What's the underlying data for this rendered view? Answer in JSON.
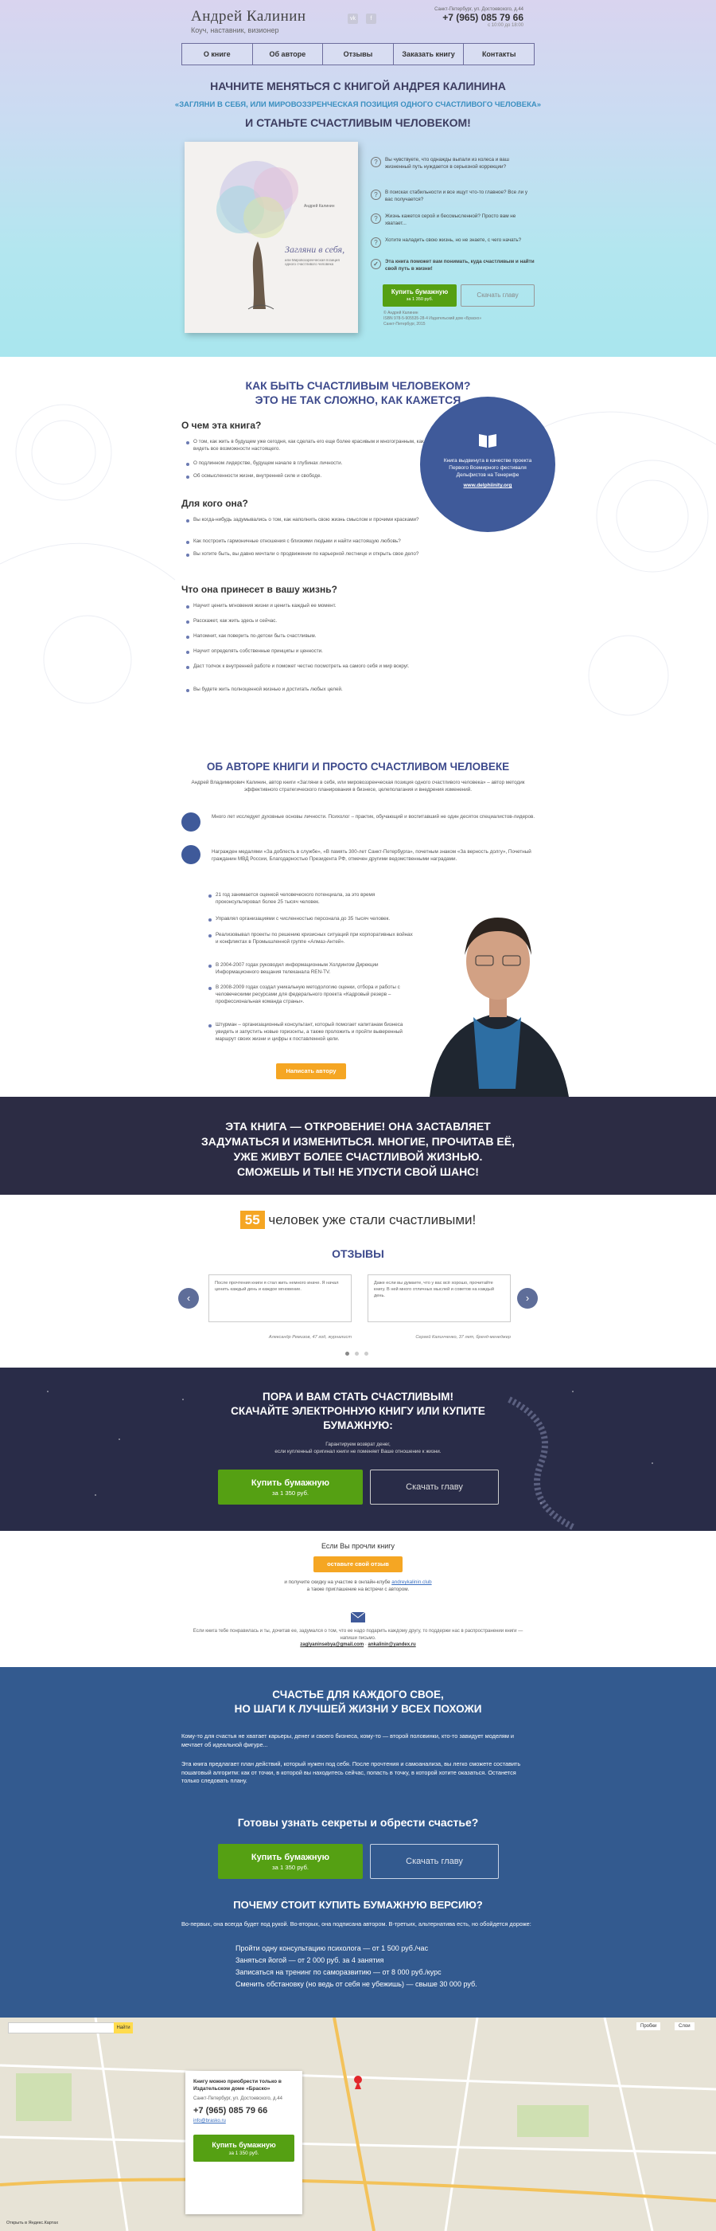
{
  "header": {
    "name": "Андрей Калинин",
    "tagline": "Коуч, наставник, визионер",
    "social": [
      "vk",
      "f"
    ],
    "city": "Санкт-Петербург, ул. Достоевского, д.44",
    "phone": "+7 (965) 085 79 66",
    "hours": "с 10:00 до 18:00"
  },
  "nav": [
    "О книге",
    "Об авторе",
    "Отзывы",
    "Заказать книгу",
    "Контакты"
  ],
  "hero": {
    "line1": "НАЧНИТЕ МЕНЯТЬСЯ С КНИГОЙ АНДРЕЯ КАЛИНИНА",
    "line2": "«ЗАГЛЯНИ В СЕБЯ, ИЛИ МИРОВОЗЗРЕНЧЕСКАЯ ПОЗИЦИЯ ОДНОГО СЧАСТЛИВОГО ЧЕЛОВЕКА»",
    "line3": "И СТАНЬТЕ СЧАСТЛИВЫМ ЧЕЛОВЕКОМ!",
    "book_author": "Андрей Калинин",
    "book_title": "Загляни в себя,",
    "book_sub": "или Мировоззренческая позиция одного счастливого человека",
    "questions": [
      "Вы чувствуете, что однажды выпали из колеса и ваш жизненный путь нуждается в серьезной коррекции?",
      "В поисках стабильности и все ищут что-то главное? Все ли у вас получается?",
      "Жизнь кажется серой и бессмысленной? Просто вам не хватает...",
      "Хотите наладить свою жизнь, но не знаете, с чего начать?"
    ],
    "cta_note": "Эта книга поможет вам понимать, куда счастливым и найти свой путь в жизни!",
    "buy_label": "Купить бумажную",
    "buy_price": "за 1 350 руб.",
    "download_label": "Скачать главу",
    "meta": "© Андрей Калинин\nISBN 978-5-905535-28-4 Издательский дом «Браско»\nСанкт-Петербург, 2015"
  },
  "about": {
    "title1": "КАК БЫТЬ СЧАСТЛИВЫМ ЧЕЛОВЕКОМ?",
    "title2": "ЭТО НЕ ТАК СЛОЖНО, КАК КАЖЕТСЯ",
    "s1": "О чем эта книга?",
    "s1_items": [
      "О том, как жить в будущем уже сегодня, как сделать его еще более красивым и многогранным, как видеть все возможности настоящего.",
      "О подлинном лидерстве, будущем начале в глубинах личности.",
      "Об осмысленности жизни, внутренней силе и свободе."
    ],
    "s2": "Для кого она?",
    "s2_items": [
      "Вы когда-нибудь задумывались о том, как наполнить свою жизнь смыслом и прочими красками?",
      "Как построить гармоничные отношения с близкими людьми и найти настоящую любовь?",
      "Вы хотите быть, вы давно мечтали о продвижении по карьерной лестнице и открыть свое дело?"
    ],
    "s3": "Что она принесет в вашу жизнь?",
    "s3_items": [
      "Научит ценить мгновения жизни и ценить каждый ее момент.",
      "Расскажет, как жить здесь и сейчас.",
      "Напомнит, как поверить по-детски быть счастливым.",
      "Научит определять собственные принципы и ценности.",
      "Даст толчок к внутренней работе и поможет честно посмотреть на самого себя и мир вокруг.",
      "Вы будете жить полноценной жизнью и достигать любых целей."
    ],
    "badge": "Книга выдвинута в качестве проекта Первого Всемирного фестиваля Дельфистов на Тенерифе",
    "badge_link": "www.delphiinity.org"
  },
  "author": {
    "title": "ОБ АВТОРЕ КНИГИ И ПРОСТО СЧАСТЛИВОМ ЧЕЛОВЕКЕ",
    "intro": "Андрей Владимирович Калинин, автор книги «Загляни в себя, или мировоззренческая позиция одного счастливого человека» – автор методик эффективного стратегического планирования в бизнесе, целеполагания и внедрения изменений.",
    "p1": "Много лет исследует духовные основы личности. Психолог – практик, обучающий и воспитавший не один десяток специалистов-лидеров.",
    "p2": "Награжден медалями «За доблесть в службе», «В память 300-лет Санкт-Петербурга», почетным знаком «За верность долгу», Почетный гражданин МВД России, Благодарностью Президента РФ, отмечен другими ведомственными наградами.",
    "list": [
      "21 год занимается оценкой человеческого потенциала, за это время проконсультировал более 25 тысяч человек.",
      "Управлял организациями с численностью персонала до 35 тысяч человек.",
      "Реализовывал проекты по решению кризисных ситуаций при корпоративных войнах и конфликтах в Промышленной группе «Алмаз-Антей».",
      "В 2004-2007 годах руководил информационным Холдингом Дирекции Информационного вещания телеканала REN-TV.",
      "В 2008-2009 годах создал уникальную методологию оценки, отбора и работы с человеческими ресурсами для федерального проекта «Кадровый резерв – профессиональная команда страны».",
      "Штурман – организационный консультант, который помогает капитанам бизнеса увидеть и запустить новые горизонты, а также проложить и пройти выверенный маршрут своих жизни и цифры к поставленной цели."
    ],
    "btn": "Написать автору"
  },
  "quote": "ЭТА КНИГА — ОТКРОВЕНИЕ! ОНА ЗАСТАВЛЯЕТ\nЗАДУМАТЬСЯ И ИЗМЕНИТЬСЯ. МНОГИЕ, ПРОЧИТАВ ЕЁ,\nУЖЕ ЖИВУТ БОЛЕЕ СЧАСТЛИВОЙ ЖИЗНЬЮ.\nСМОЖЕШЬ И ТЫ! НЕ УПУСТИ СВОЙ ШАНС!",
  "reviews": {
    "count": "55",
    "count_text": "человек уже стали счастливыми!",
    "title": "ОТЗЫВЫ",
    "items": [
      {
        "text": "После прочтения книги я стал жить немного иначе. Я начал ценить каждый день и каждое мгновение.",
        "author": "Александр Ремизов, 47 год, журналист"
      },
      {
        "text": "Даже если вы думаете, что у вас всё хорошо, прочитайте книгу. В ней много отличных мыслей и советов на каждый день.",
        "author": "Сергей Калинченко, 37 лет, бренд-менеджер"
      }
    ]
  },
  "download": {
    "title": "ПОРА И ВАМ СТАТЬ СЧАСТЛИВЫМ!\nСКАЧАЙТЕ ЭЛЕКТРОННУЮ КНИГУ ИЛИ КУПИТЕ\nБУМАЖНУЮ:",
    "note": "Гарантируем возврат денег,\nесли купленный оригинал книги не поменяет Ваше отношение к жизни.",
    "buy": "Купить бумажную",
    "price": "за 1 350 руб.",
    "chapter": "Скачать главу"
  },
  "leave": {
    "q": "Если Вы прочли книгу",
    "btn": "оставьте свой отзыв",
    "t1": "и получите скидку на участие в онлайн-клубе",
    "link": "andreykalinin.club",
    "t2": "а также приглашение на встречи с автором.",
    "text": "Если книга тебе понравилась и ты, дочитав ее, задумался о том, что ее надо подарить каждому другу, то поддержи нас в распространении книги — напиши письмо.",
    "email1": "zaglyaninsebya@gmail.com",
    "email2": "ankalinin@yandex.ru"
  },
  "blue": {
    "title": "СЧАСТЬЕ ДЛЯ КАЖДОГО СВОЕ,\nНО ШАГИ К ЛУЧШЕЙ ЖИЗНИ У ВСЕХ ПОХОЖИ",
    "p1": "Кому-то для счастья не хватает карьеры, денег и своего бизнеса, кому-то — второй половинки, кто-то завидует моделям и мечтает об идеальной фигуре...",
    "p2": "Эта книга предлагает план действий, который нужен под себя. После прочтения и самоанализа, вы легко сможете составить пошаговый алгоритм: как от точки, в которой вы находитесь сейчас, попасть в точку, в которой хотите оказаться. Останется только следовать плану.",
    "q": "Готовы узнать секреты и обрести счастье?",
    "buy": "Купить бумажную",
    "price": "за 1 350 руб.",
    "chapter": "Скачать главу",
    "why": "ПОЧЕМУ СТОИТ КУПИТЬ БУМАЖНУЮ ВЕРСИЮ?",
    "why_text": "Во-первых, она всегда будет под рукой. Во-вторых, она подписана автором. В-третьих, альтернатива есть, но обойдется дороже:",
    "items": [
      "Пройти одну консультацию психолога — от 1 500 руб./час",
      "Заняться йогой — от 2 000 руб. за 4 занятия",
      "Записаться на тренинг по саморазвитию — от 8 000 руб./курс",
      "Сменить обстановку (но ведь от себя не убежишь) — свыше 30 000 руб."
    ]
  },
  "map": {
    "search_label": "Найти",
    "toolbar": [
      "Пробки",
      "Слои"
    ],
    "card_title": "Книгу можно приобрести только в Издательском доме «Браско»",
    "card_addr": "Санкт-Петербург, ул. Достоевского, д.44",
    "card_phone": "+7 (965) 085 79 66",
    "card_email": "info@brasko.ru",
    "buy": "Купить бумажную",
    "price": "за 1 350 руб.",
    "foot": "Открыть в Яндекс.Картах"
  },
  "colors": {
    "accent": "#3d4a8c",
    "green": "#55a013",
    "orange": "#f5a623",
    "dark": "#2c2c44",
    "blue": "#335a8f"
  }
}
